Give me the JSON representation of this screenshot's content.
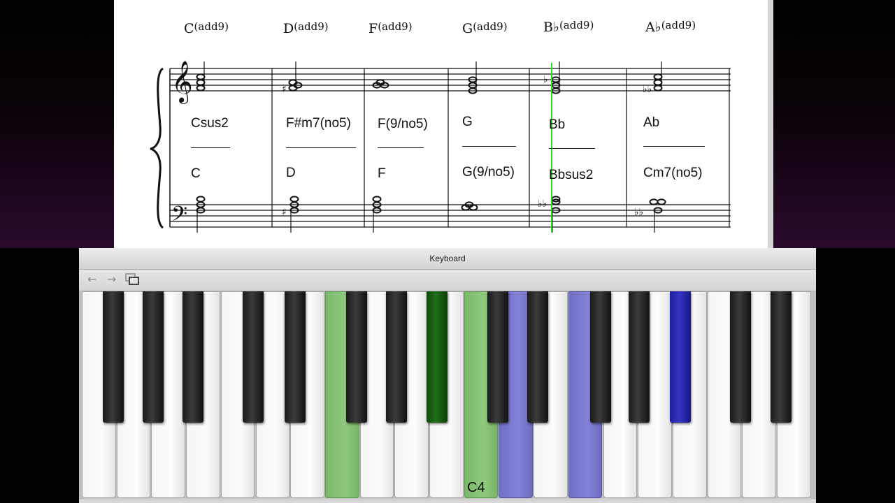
{
  "score": {
    "chord_symbols": [
      {
        "root": "C",
        "ext": "(add9)"
      },
      {
        "root": "D",
        "ext": "(add9)"
      },
      {
        "root": "F",
        "ext": "(add9)"
      },
      {
        "root": "G",
        "ext": "(add9)"
      },
      {
        "root": "B♭",
        "ext": "(add9)"
      },
      {
        "root": "A♭",
        "ext": "(add9)"
      }
    ],
    "upper_analysis": [
      "Csus2",
      "F#m7(no5)",
      "F(9/no5)",
      "G",
      "Bb",
      "Ab"
    ],
    "lower_analysis": [
      "C",
      "D",
      "F",
      "G(9/no5)",
      "Bbsus2",
      "Cm7(no5)"
    ],
    "playhead_color": "#22dd22"
  },
  "keyboard_window": {
    "title": "Keyboard",
    "toolbar": {
      "back_icon": "arrow-left-icon",
      "forward_icon": "arrow-right-icon",
      "window_icon": "window-stack-icon"
    },
    "middle_c_label": "C4",
    "highlight_colors": {
      "green": "#8fca7c",
      "blue": "#8482d6"
    }
  }
}
